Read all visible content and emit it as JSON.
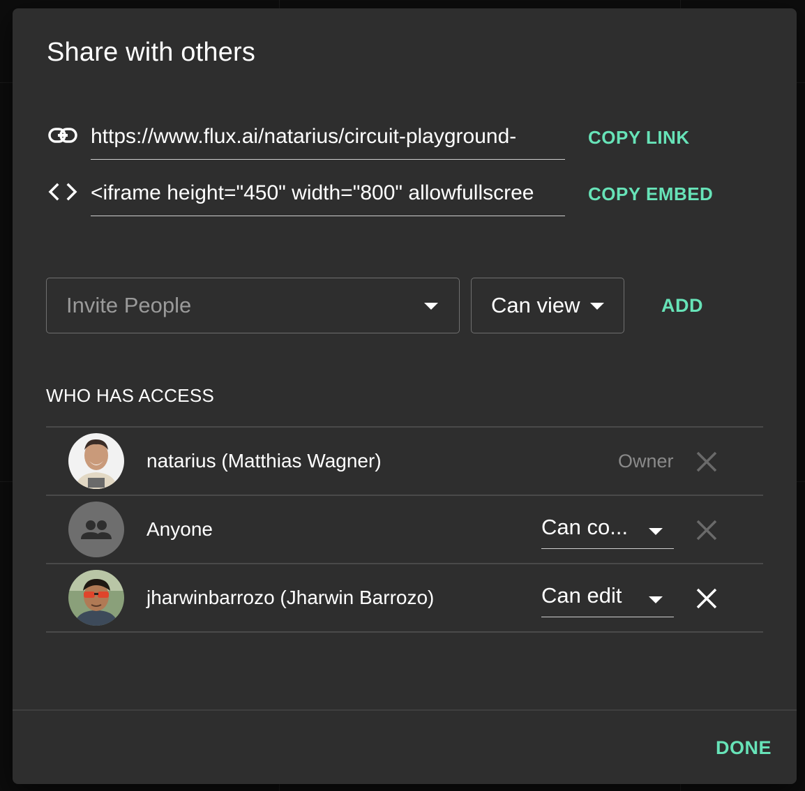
{
  "dialog": {
    "title": "Share with others",
    "link": {
      "value": "https://www.flux.ai/natarius/circuit-playground-",
      "copy_label": "COPY LINK",
      "icon": "link-icon"
    },
    "embed": {
      "value": "<iframe height=\"450\" width=\"800\" allowfullscree",
      "copy_label": "COPY EMBED",
      "icon": "code-icon"
    },
    "invite": {
      "placeholder": "Invite People",
      "permission": "Can view",
      "add_label": "ADD"
    },
    "access": {
      "heading": "WHO HAS ACCESS",
      "rows": [
        {
          "name": "natarius (Matthias Wagner)",
          "role": "Owner"
        },
        {
          "name": "Anyone",
          "role": "Can co..."
        },
        {
          "name": "jharwinbarrozo (Jharwin Barrozo)",
          "role": "Can edit"
        }
      ]
    },
    "done_label": "DONE"
  },
  "colors": {
    "accent": "#67e3b8",
    "dialog_bg": "#2e2e2e",
    "muted_text": "#8a8a8a"
  }
}
